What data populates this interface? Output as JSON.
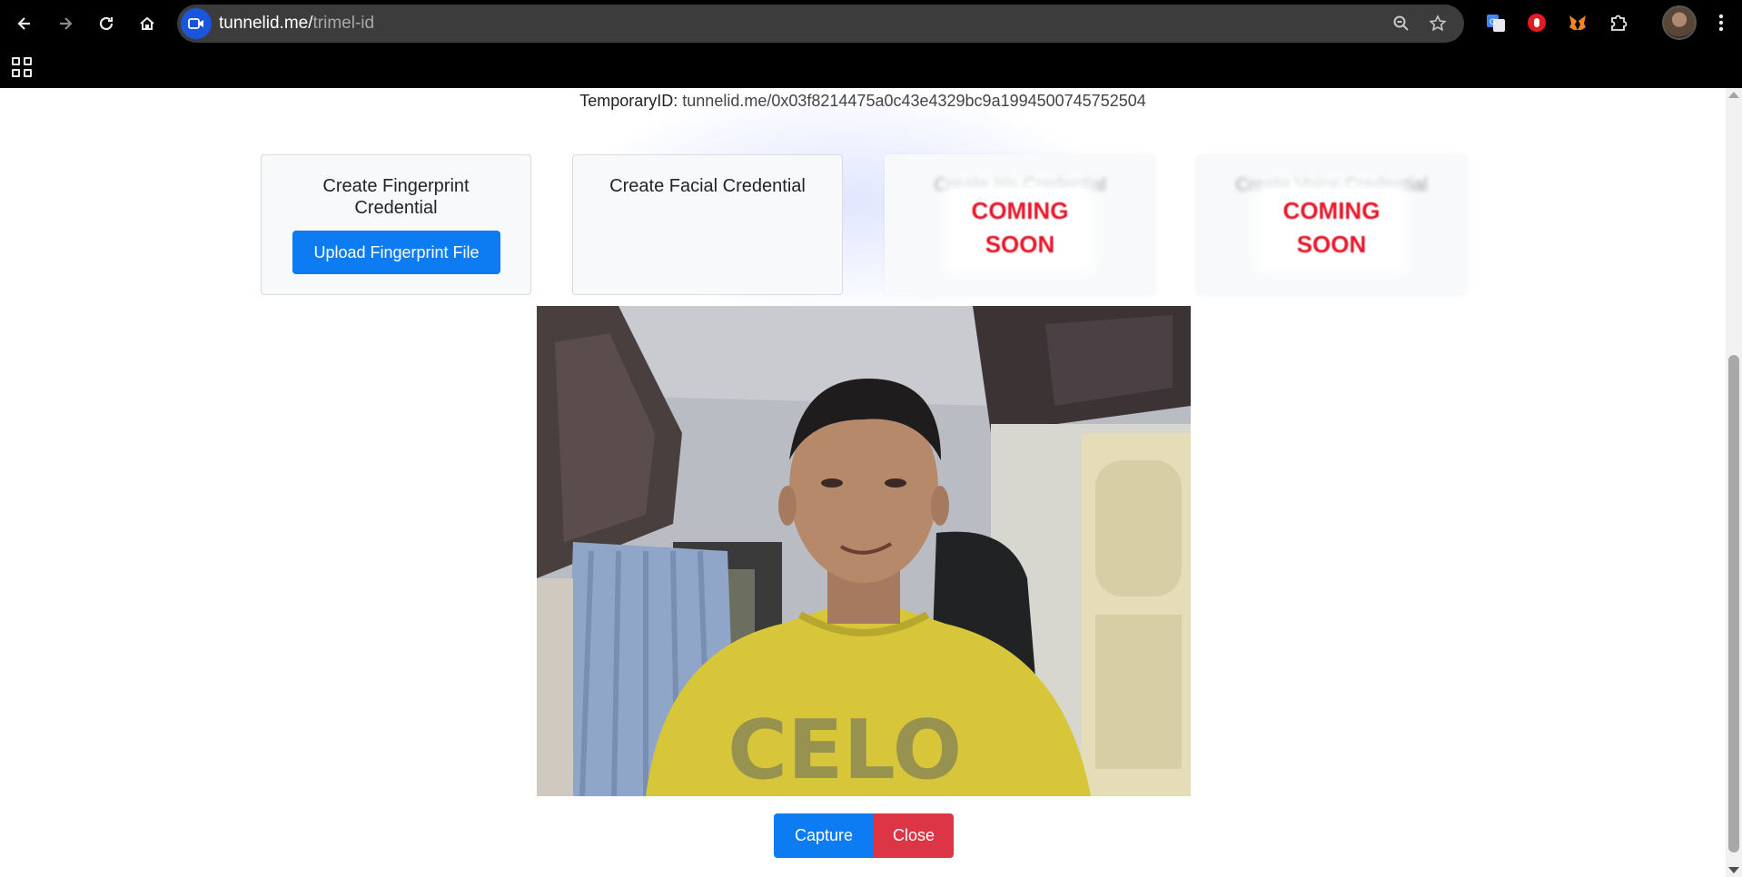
{
  "browser": {
    "url_host": "tunnelid.me/",
    "url_path": "trimel-id",
    "icons": [
      "back-icon",
      "forward-icon",
      "reload-icon",
      "home-icon",
      "zoom-icon",
      "star-icon",
      "translate-extension-icon",
      "adblock-extension-icon",
      "metamask-extension-icon",
      "extensions-puzzle-icon",
      "menu-kebab-icon",
      "apps-grid-icon"
    ]
  },
  "page": {
    "temporary_id_label": "TemporaryID:",
    "temporary_id_value": "tunnelid.me/0x03f8214475a0c43e4329bc9a1994500745752504"
  },
  "cards": {
    "fingerprint": {
      "title": "Create Fingerprint Credential",
      "button": "Upload Fingerprint File"
    },
    "facial": {
      "title": "Create Facial Credential"
    },
    "iris": {
      "title": "Create Iris Credential",
      "badge_line1": "COMING",
      "badge_line2": "SOON"
    },
    "voice": {
      "title": "Create Voice Credential",
      "badge_line1": "COMING",
      "badge_line2": "SOON"
    }
  },
  "actions": {
    "capture": "Capture",
    "close": "Close"
  },
  "colors": {
    "primary": "#0d7cf2",
    "danger": "#dc3545",
    "coming_soon": "#e8192c"
  }
}
